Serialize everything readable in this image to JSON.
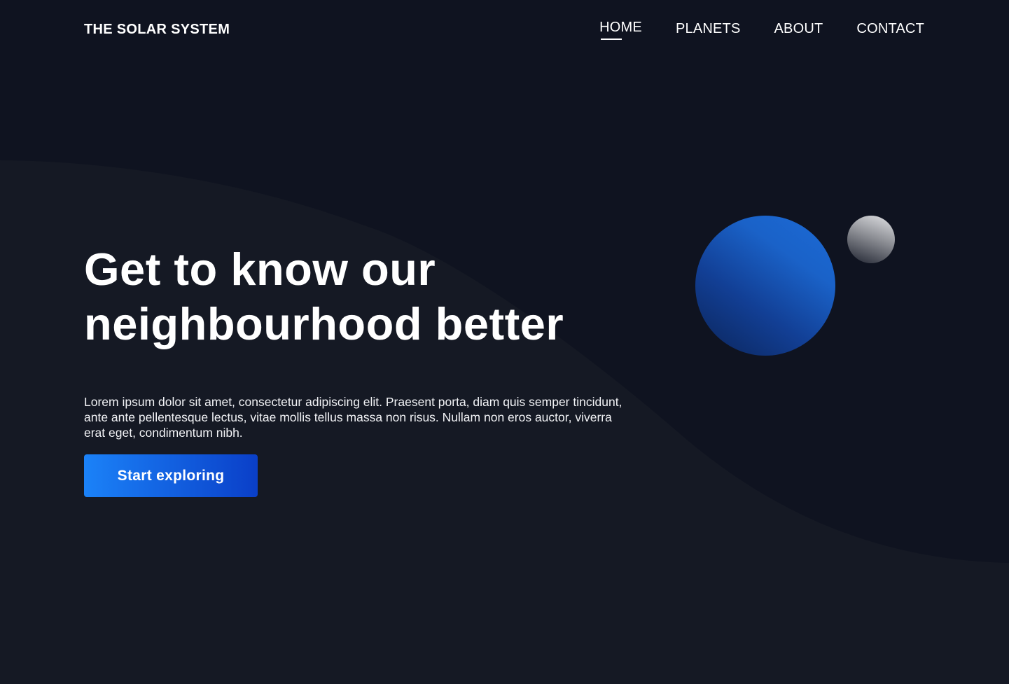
{
  "header": {
    "logo": "THE SOLAR SYSTEM",
    "nav": [
      {
        "label": "HOME",
        "active": true
      },
      {
        "label": "PLANETS",
        "active": false
      },
      {
        "label": "ABOUT",
        "active": false
      },
      {
        "label": "CONTACT",
        "active": false
      }
    ]
  },
  "hero": {
    "title_line1": "Get to know our",
    "title_line2": "neighbourhood better",
    "description": "Lorem ipsum dolor sit amet, consectetur adipiscing elit. Praesent porta, diam quis semper tincidunt, ante ante pellentesque lectus, vitae mollis tellus massa non risus. Nullam non eros auctor, viverra erat eget, condimentum nibh.",
    "cta_label": "Start exploring"
  },
  "decorations": {
    "planets": [
      "blue-planet",
      "grey-moon"
    ]
  },
  "colors": {
    "background_dark": "#0f1320",
    "background_light": "#151924",
    "accent_start": "#1b82f8",
    "accent_end": "#0a3fc8",
    "text": "#ffffff"
  }
}
